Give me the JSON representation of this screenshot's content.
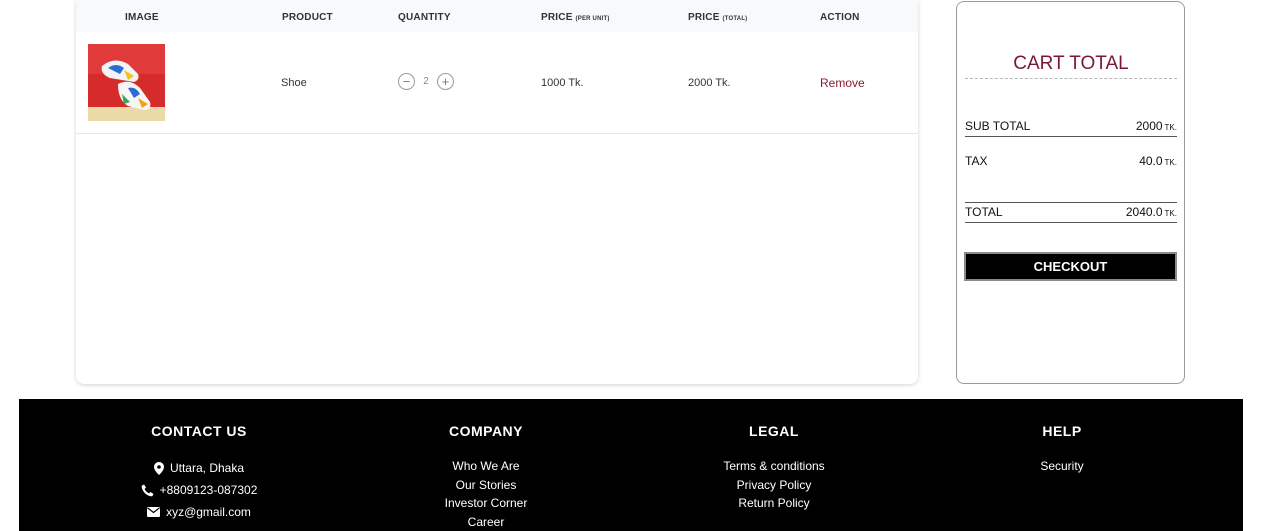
{
  "table": {
    "headers": {
      "image": "IMAGE",
      "product": "PRODUCT",
      "quantity": "QUANTITY",
      "price_unit": "PRICE",
      "price_unit_note": "(PER UNIT)",
      "price_total": "PRICE",
      "price_total_note": "(TOTAL)",
      "action": "ACTION"
    },
    "items": [
      {
        "product": "Shoe",
        "quantity": "2",
        "price_unit": "1000 Tk.",
        "price_total": "2000 Tk.",
        "action": "Remove",
        "qty_minus": "−",
        "qty_plus": "+"
      }
    ]
  },
  "summary": {
    "title": "CART TOTAL",
    "subtotal_label": "SUB TOTAL",
    "subtotal_value": "2000",
    "tax_label": "TAX",
    "tax_value": "40.0",
    "total_label": "TOTAL",
    "total_value": "2040.0",
    "currency": "TK.",
    "checkout_label": "CHECKOUT"
  },
  "footer": {
    "contact": {
      "title": "CONTACT US",
      "address": "Uttara, Dhaka",
      "phone": "+8809123-087302",
      "email": "xyz@gmail.com"
    },
    "company": {
      "title": "COMPANY",
      "links": [
        "Who We Are",
        "Our Stories",
        "Investor Corner",
        "Career"
      ]
    },
    "legal": {
      "title": "LEGAL",
      "links": [
        "Terms & conditions",
        "Privacy Policy",
        "Return Policy"
      ]
    },
    "help": {
      "title": "HELP",
      "links": [
        "Security"
      ]
    }
  },
  "colors": {
    "accent": "#7a1637",
    "remove": "#8a1b2e",
    "footer_bg": "#000000"
  }
}
